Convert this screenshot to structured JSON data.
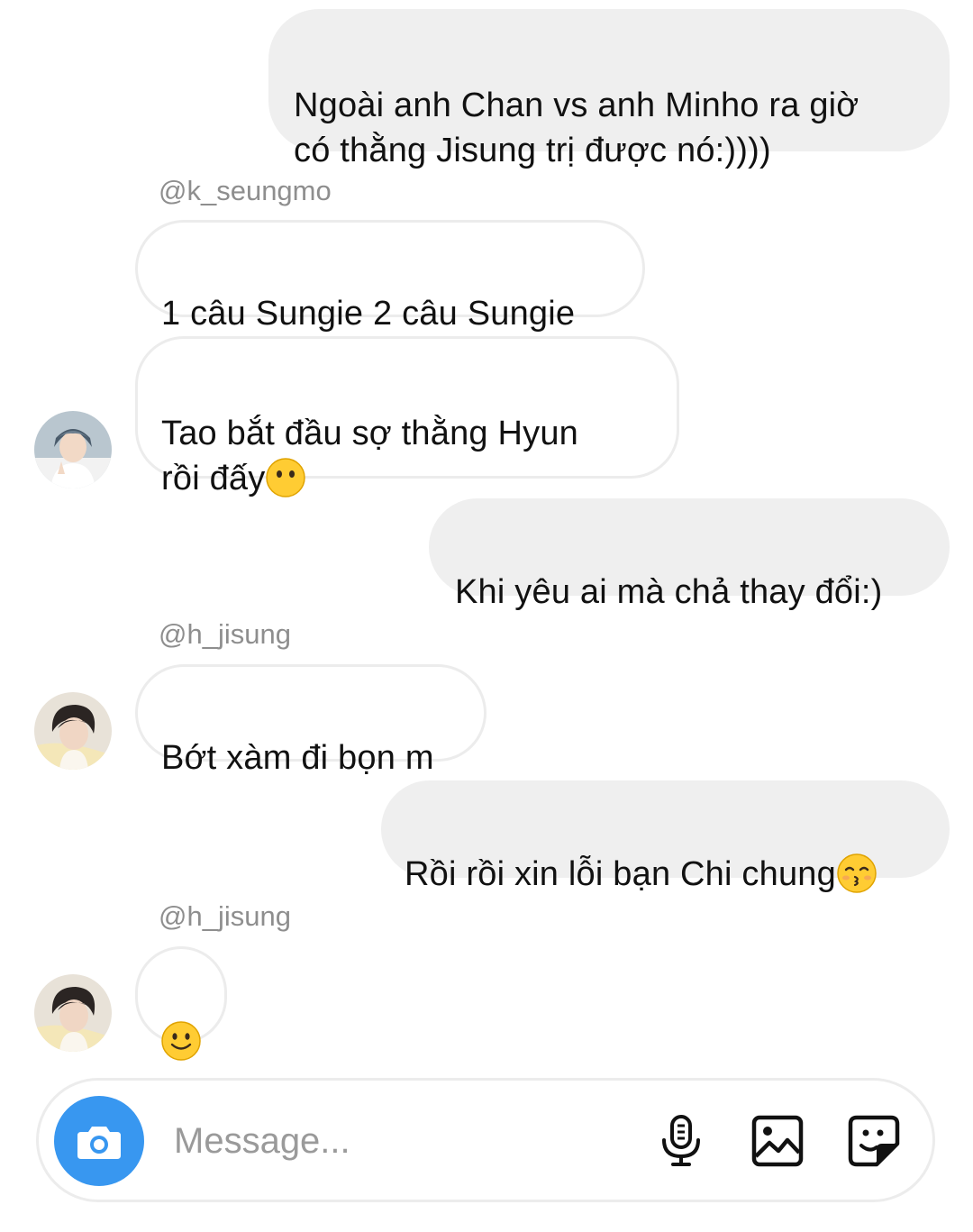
{
  "messages": [
    {
      "text": "Ngoài anh Chan vs anh Minho ra giờ\ncó thằng Jisung trị được nó:))))",
      "direction": "outgoing"
    },
    {
      "username": "@k_seungmo",
      "text": "1 câu Sungie 2 câu Sungie",
      "direction": "incoming"
    },
    {
      "text": "Tao bắt đầu sợ thằng Hyun\nrồi đấy",
      "emoji": "no-mouth-face",
      "direction": "incoming"
    },
    {
      "text": "Khi yêu ai mà chả thay đổi:)",
      "direction": "outgoing"
    },
    {
      "username": "@h_jisung",
      "text": "Bớt xàm đi bọn m",
      "direction": "incoming"
    },
    {
      "text": "Rồi rồi xin lỗi bạn Chi chung",
      "emoji": "kissing-face",
      "direction": "outgoing"
    },
    {
      "username": "@h_jisung",
      "emoji": "slightly-smiling-face",
      "direction": "incoming"
    }
  ],
  "composer": {
    "placeholder": "Message...",
    "accent_color": "#3897f0",
    "icons": [
      "camera-icon",
      "microphone-icon",
      "gallery-icon",
      "sticker-icon"
    ]
  },
  "colors": {
    "outgoing_bubble": "#efefef",
    "incoming_border": "#ececec",
    "username": "#8e8e8e"
  }
}
